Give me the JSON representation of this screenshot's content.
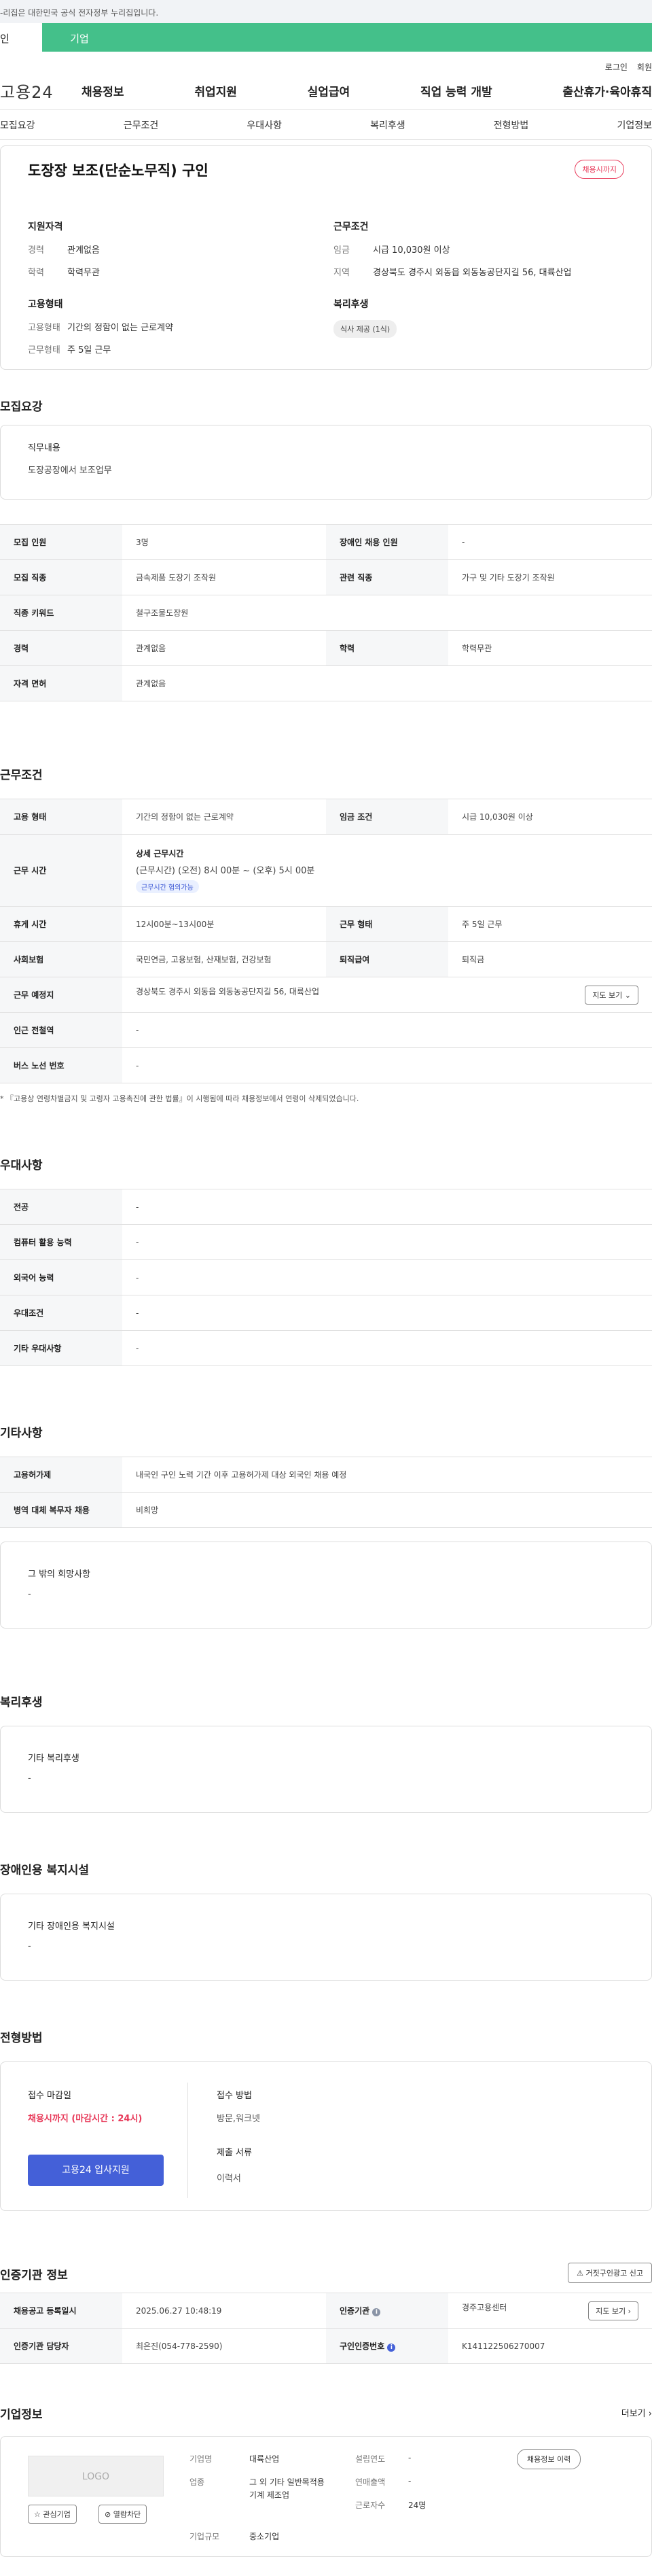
{
  "gov_banner": "-리집은 대한민국 공식 전자정부 누리집입니다.",
  "tabs": {
    "individual": "인",
    "company": "기업"
  },
  "util": {
    "login": "로그인",
    "signup": "회원"
  },
  "logo": "고용24",
  "gnb": [
    "채용정보",
    "취업지원",
    "실업급여",
    "직업 능력 개발",
    "출산휴가·육아휴직"
  ],
  "subnav": [
    "모집요강",
    "근무조건",
    "우대사항",
    "복리후생",
    "전형방법",
    "기업정보"
  ],
  "summary": {
    "title": "도장장 보조(단순노무직) 구인",
    "status": "채용시까지",
    "qualification": {
      "heading": "지원자격",
      "career_label": "경력",
      "career_value": "관계없음",
      "edu_label": "학력",
      "edu_value": "학력무관"
    },
    "condition": {
      "heading": "근무조건",
      "wage_label": "임금",
      "wage_value": "시급 10,030원 이상",
      "region_label": "지역",
      "region_value": "경상북도 경주시 외동읍 외동농공단지길 56, 대륙산업"
    },
    "employment": {
      "heading": "고용형태",
      "type_label": "고용형태",
      "type_value": "기간의 정함이 없는 근로계약",
      "days_label": "근무형태",
      "days_value": "주 5일 근무"
    },
    "welfare": {
      "heading": "복리후생",
      "chip": "식사 제공 (1식)"
    }
  },
  "recruit": {
    "heading": "모집요강",
    "duty_label": "직무내용",
    "duty_value": "도장공장에서 보조업무",
    "rows": [
      [
        "모집 인원",
        "3명",
        "장애인 채용 인원",
        "-"
      ],
      [
        "모집 직종",
        "금속제품 도장기 조작원",
        "관련 직종",
        "가구 및 기타 도장기 조작원"
      ],
      [
        "직종 키워드",
        "철구조물도장원",
        "",
        ""
      ],
      [
        "경력",
        "관계없음",
        "학력",
        "학력무관"
      ],
      [
        "자격 면허",
        "관계없음",
        "",
        ""
      ]
    ]
  },
  "work": {
    "heading": "근무조건",
    "type_label": "고용 형태",
    "type_value": "기간의 정함이 없는 근로계약",
    "wage_label": "임금 조건",
    "wage_value": "시급 10,030원 이상",
    "time_label": "근무 시간",
    "time_title": "상세 근무시간",
    "time_value": "(근무시간) (오전) 8시 00분 ~ (오후) 5시 00분",
    "time_tag": "근무시간 협의가능",
    "break_label": "휴게 시간",
    "break_value": "12시00분~13시00분",
    "form_label": "근무 형태",
    "form_value": "주 5일 근무",
    "insurance_label": "사회보험",
    "insurance_value": "국민연금, 고용보험, 산재보험, 건강보험",
    "retire_label": "퇴직급여",
    "retire_value": "퇴직금",
    "place_label": "근무 예정지",
    "place_value": "경상북도 경주시 외동읍 외동농공단지길 56, 대륙산업",
    "map_button": "지도 보기",
    "subway_label": "인근 전철역",
    "subway_value": "-",
    "bus_label": "버스 노선 번호",
    "bus_value": "-",
    "note": "* 『고용상 연령차별금지 및 고령자 고용촉진에 관한 법률』이 시행됨에 따라 채용정보에서 연령이 삭제되었습니다."
  },
  "preference": {
    "heading": "우대사항",
    "rows": [
      [
        "전공",
        "-"
      ],
      [
        "컴퓨터 활용 능력",
        "-"
      ],
      [
        "외국어 능력",
        "-"
      ],
      [
        "우대조건",
        "-"
      ],
      [
        "기타 우대사항",
        "-"
      ]
    ]
  },
  "etc": {
    "heading": "기타사항",
    "rows": [
      [
        "고용허가제",
        "내국인 구인 노력 기간 이후 고용허가제 대상 외국인 채용 예정"
      ],
      [
        "병역 대체 복무자 채용",
        "비희망"
      ]
    ],
    "other_label": "그 밖의 희망사항",
    "other_value": "-"
  },
  "benefit": {
    "heading": "복리후생",
    "label": "기타 복리후생",
    "value": "-"
  },
  "disabled": {
    "heading": "장애인용 복지시설",
    "label": "기타 장애인용 복지시설",
    "value": "-"
  },
  "apply": {
    "heading": "전형방법",
    "deadline_label": "접수 마감일",
    "deadline_value": "채용시까지 (마감시간 : 24시)",
    "button": "고용24 입사지원",
    "method_label": "접수 방법",
    "method_value": "방문,워크넷",
    "docs_label": "제출 서류",
    "docs_value": "이력서"
  },
  "agency": {
    "heading": "인증기관 정보",
    "report_button": "거짓구인광고 신고",
    "reg_label": "채용공고 등록일시",
    "reg_value": "2025.06.27 10:48:19",
    "org_label": "인증기관",
    "org_value": "경주고용센터",
    "map_button": "지도 보기",
    "staff_label": "인증기관 담당자",
    "staff_value": "최은진(054-778-2590)",
    "num_label": "구인인증번호",
    "num_value": "K141122506270007"
  },
  "company": {
    "heading": "기업정보",
    "more": "더보기",
    "logo_text": "LOGO",
    "interest_button": "관심기업",
    "block_button": "열람차단",
    "name_label": "기업명",
    "name_value": "대륙산업",
    "industry_label": "업종",
    "industry_value": "그 외 기타 일반목적용 기계 제조업",
    "size_label": "기업규모",
    "size_value": "중소기업",
    "founded_label": "설립연도",
    "founded_value": "-",
    "sales_label": "연매출액",
    "sales_value": "-",
    "workers_label": "근로자수",
    "workers_value": "24명",
    "history_button": "채용정보 이력"
  },
  "colors": {
    "brand_green": "#44c08a",
    "accent_red": "#e83a5a",
    "primary_blue": "#4460d8"
  }
}
